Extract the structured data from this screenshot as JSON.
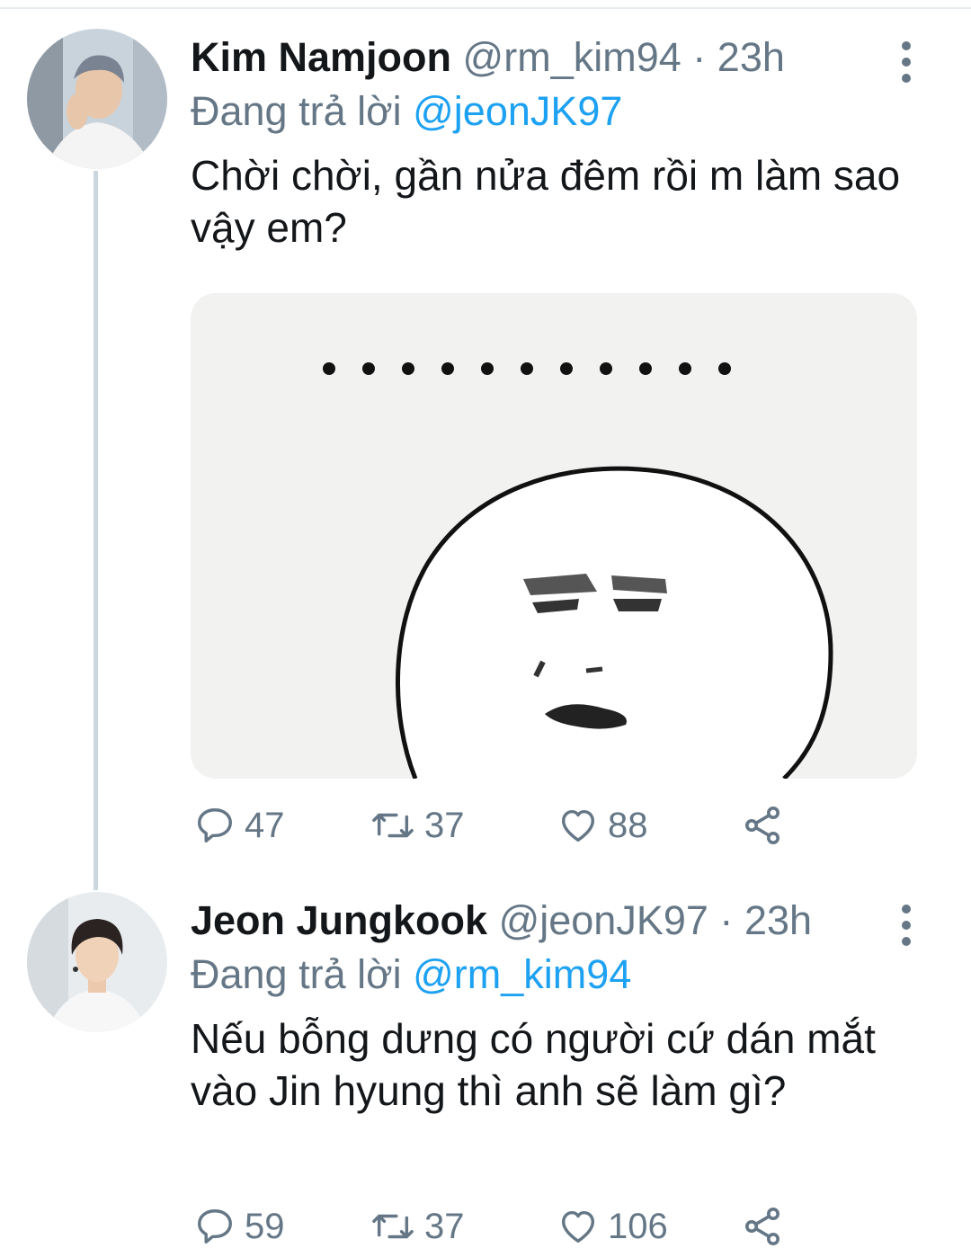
{
  "tweets": [
    {
      "name": "Kim Namjoon",
      "handle": "@rm_kim94",
      "separator": "·",
      "time": "23h",
      "reply_prefix": "Đang trả lời",
      "reply_to": "@jeonJK97",
      "text": "Chời chời, gần nửa đêm rồi m làm sao vậy em?",
      "media": {
        "description_icon": "meme-face",
        "dots_count": 11
      },
      "stats": {
        "replies": "47",
        "retweets": "37",
        "likes": "88"
      }
    },
    {
      "name": "Jeon Jungkook",
      "handle": "@jeonJK97",
      "separator": "·",
      "time": "23h",
      "reply_prefix": "Đang trả lời",
      "reply_to": "@rm_kim94",
      "text": "Nếu bỗng dưng có người cứ dán mắt vào Jin hyung thì anh sẽ làm gì?",
      "stats": {
        "replies": "59",
        "retweets": "37",
        "likes": "106"
      }
    }
  ],
  "icons": {
    "reply": "reply-icon",
    "retweet": "retweet-icon",
    "like": "heart-icon",
    "share": "share-icon",
    "more": "more-vertical-icon"
  },
  "colors": {
    "accent": "#1da1f2",
    "secondary_text": "#657786",
    "thread_line": "#ccd6dd"
  }
}
